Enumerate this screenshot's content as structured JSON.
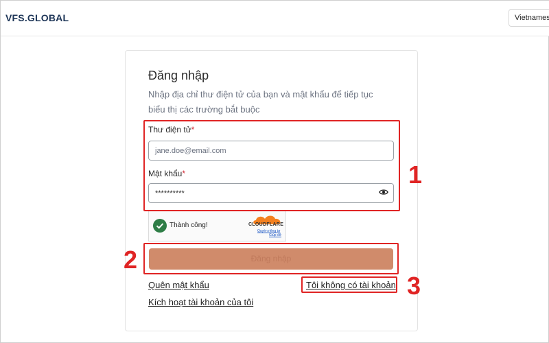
{
  "header": {
    "logo": "VFS.GLOBAL",
    "language": "Vietnamese"
  },
  "login": {
    "title": "Đăng nhập",
    "subtitle": "Nhập địa chỉ thư điện tử của bạn và mật khẩu để tiếp tục",
    "required_note": "biểu thị các trường bắt buộc",
    "email_label": "Thư điện tử",
    "email_placeholder": "jane.doe@email.com",
    "password_label": "Mật khẩu",
    "password_value": "**********",
    "required_mark": "*",
    "captcha_status": "Thành công!",
    "captcha_brand": "CLOUDFLARE",
    "captcha_privacy": "Quyền riêng tư",
    "captcha_help": "Giúp đỡ",
    "submit_label": "Đăng nhập",
    "forgot_password": "Quên mật khẩu",
    "no_account": "Tôi không có tài khoản",
    "activate_account": "Kích hoạt tài khoản của tôi"
  },
  "annotations": {
    "one": "1",
    "two": "2",
    "three": "3",
    "color": "#e02424"
  },
  "colors": {
    "button": "#d08b6b",
    "success": "#2e7d46",
    "cloudflare": "#f38020"
  }
}
